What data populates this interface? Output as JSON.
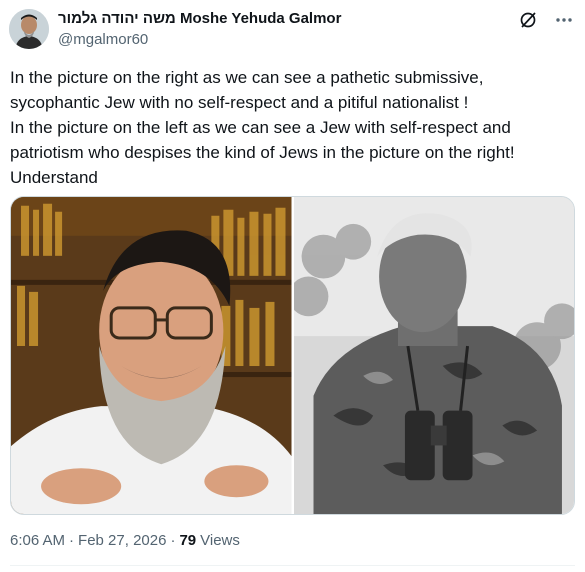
{
  "author": {
    "display_name": "משה יהודה גלמור Moshe Yehuda Galmor",
    "handle": "@mgalmor60"
  },
  "icons": {
    "grok": "grok-icon",
    "more": "more-icon"
  },
  "tweet": {
    "text": "In the picture on the right as we can see a pathetic submissive, sycophantic Jew with no self-respect and a pitiful nationalist !\nIn the picture on the left as we can see a Jew with self-respect and patriotism who despises the kind of Jews in the picture on the right!\nUnderstand"
  },
  "media": {
    "count": 2
  },
  "meta": {
    "time": "6:06 AM",
    "separator": "·",
    "date": "Feb 27, 2026",
    "views_count": "79",
    "views_label": "Views"
  },
  "colors": {
    "text": "#0f1419",
    "secondary": "#536471",
    "border": "#cfd9de"
  }
}
